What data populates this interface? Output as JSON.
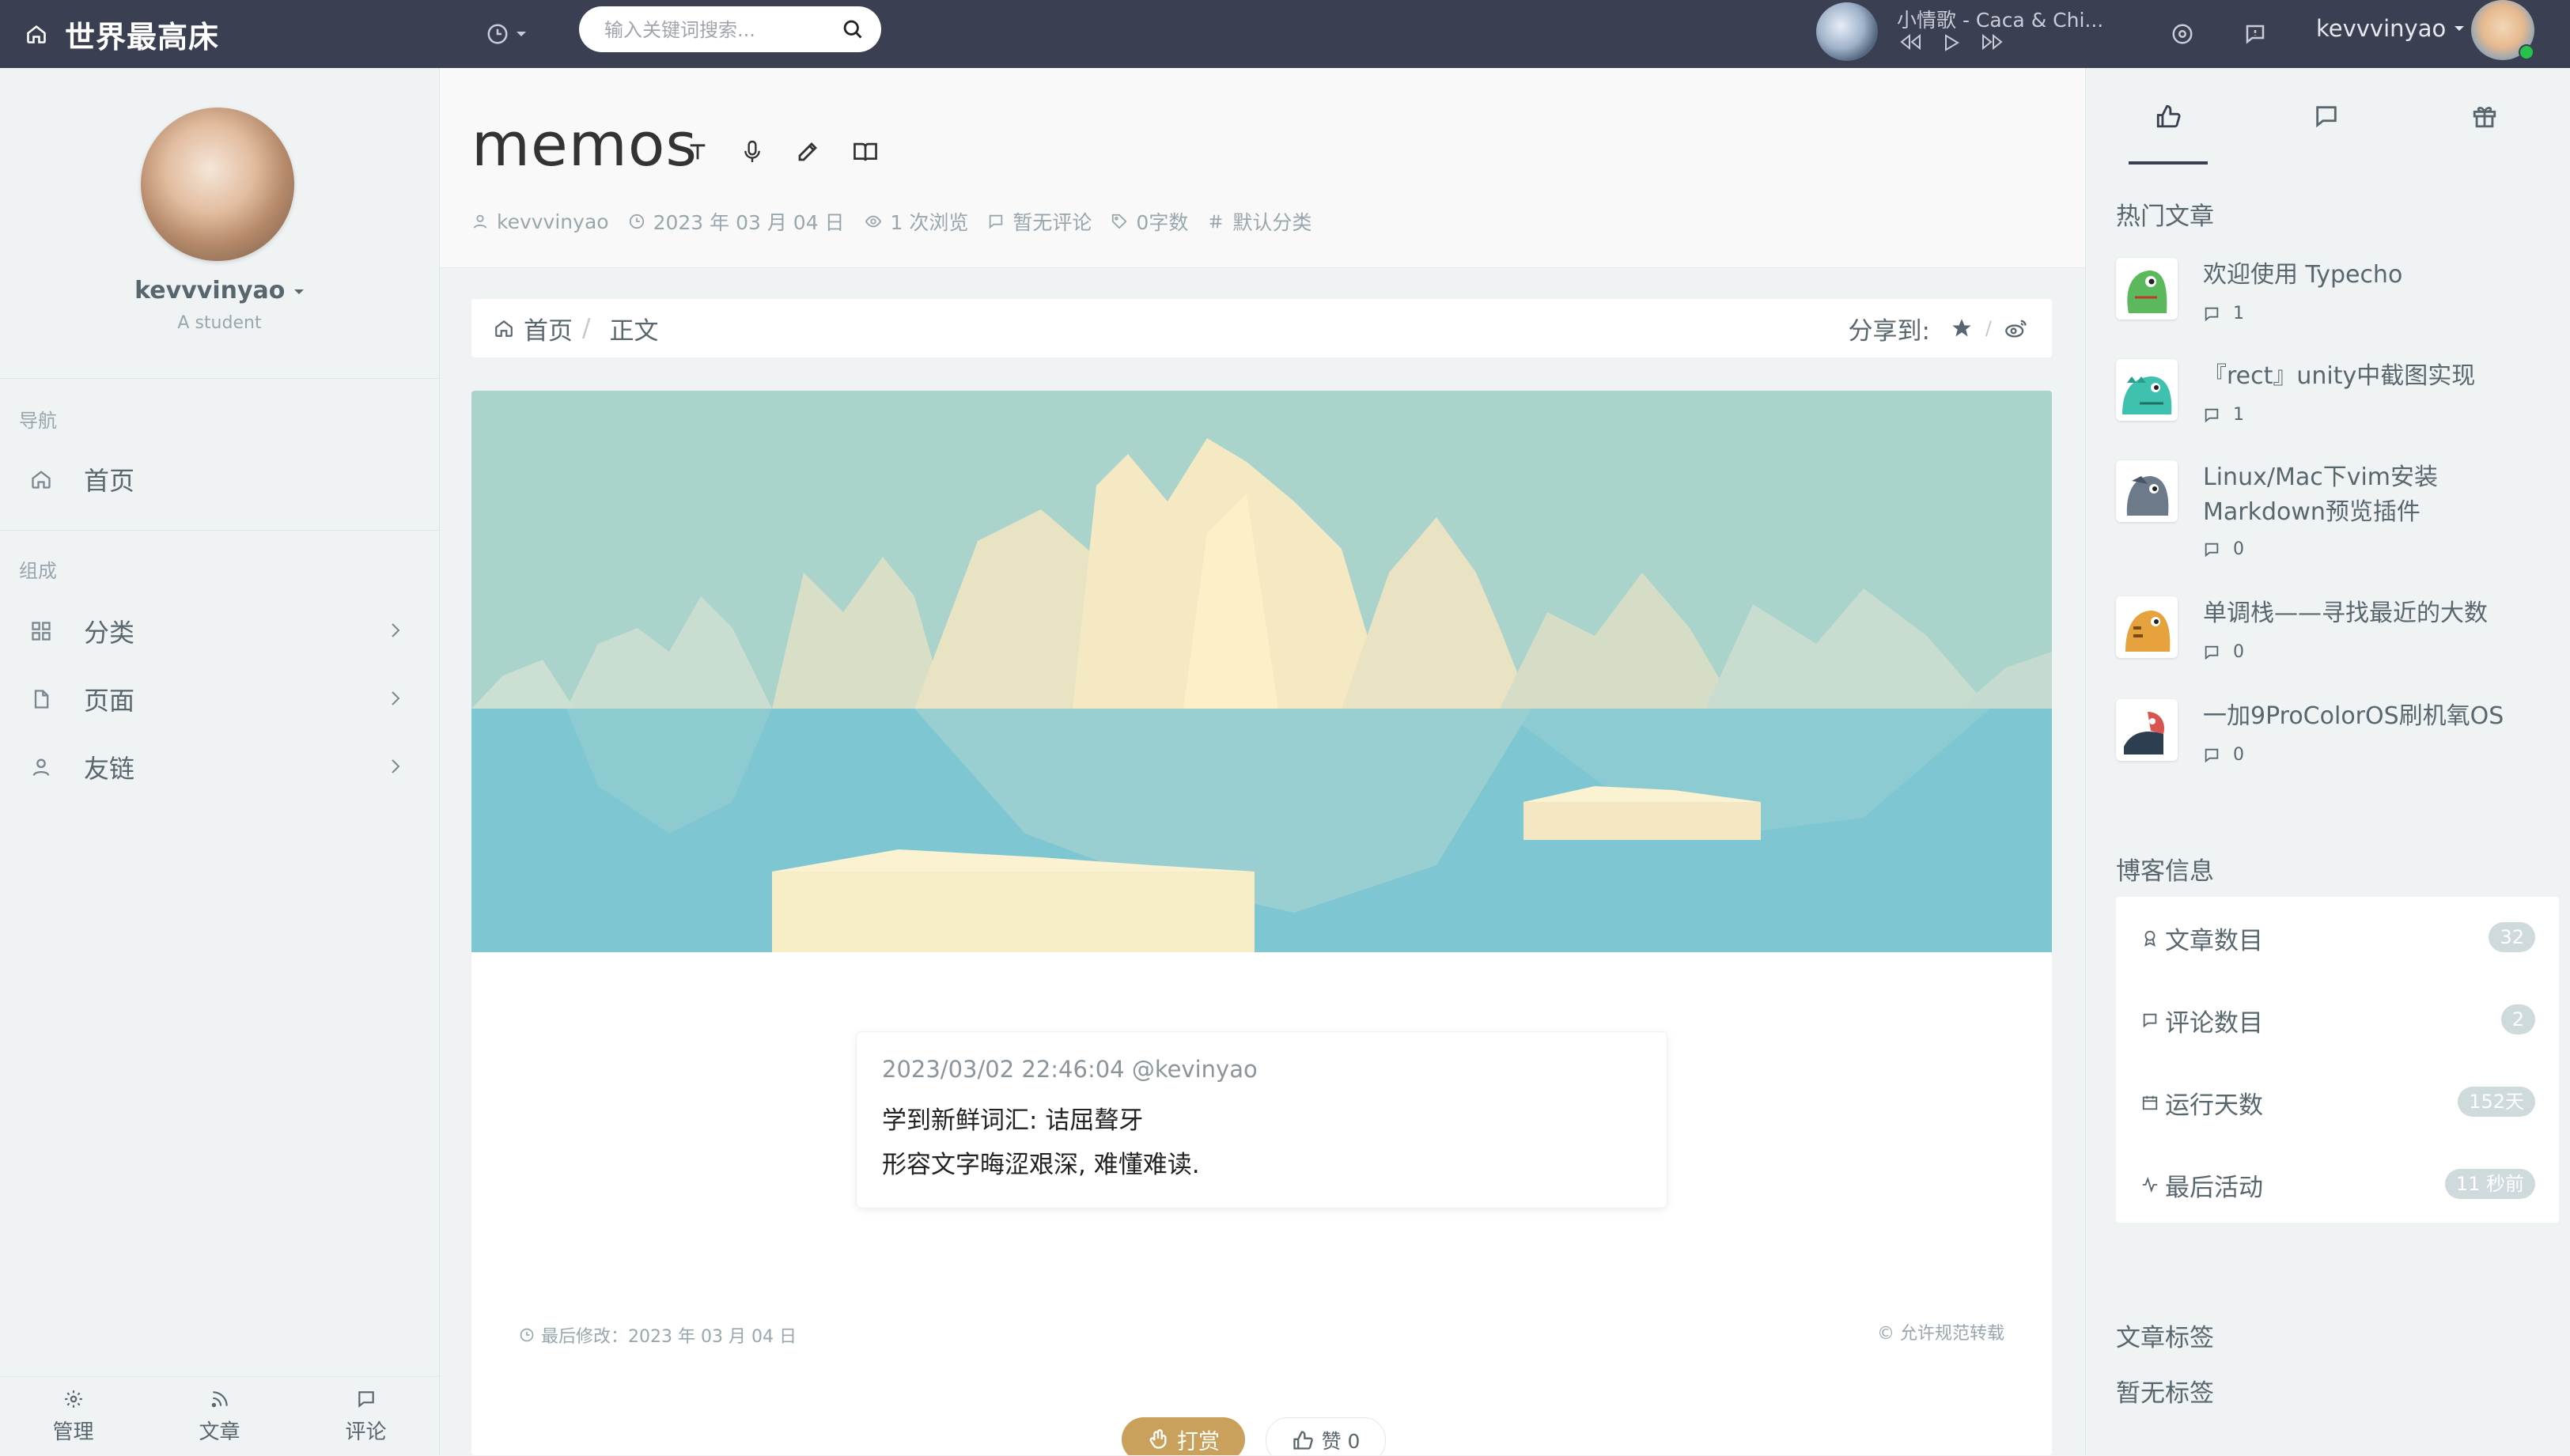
{
  "header": {
    "site_title": "世界最高床",
    "search_placeholder": "输入关键词搜索...",
    "song": "小情歌 - Caca & Chi...",
    "user_name": "kevvvinyao"
  },
  "aside": {
    "name": "kevvvinyao",
    "subtitle": "A student",
    "nav_heading": "导航",
    "home": "首页",
    "compose_heading": "组成",
    "items": [
      {
        "label": "分类"
      },
      {
        "label": "页面"
      },
      {
        "label": "友链"
      }
    ],
    "footer": [
      {
        "label": "管理"
      },
      {
        "label": "文章"
      },
      {
        "label": "评论"
      }
    ]
  },
  "post": {
    "title": "memos",
    "meta": {
      "author": "kevvvinyao",
      "date": "2023 年 03 月 04 日",
      "views": "1 次浏览",
      "comments": "暂无评论",
      "words": "0字数",
      "category": "默认分类"
    },
    "breadcrumb": {
      "home": "首页",
      "current": "正文"
    },
    "share_label": "分享到:",
    "memo": {
      "time": "2023/03/02 22:46:04  @kevinyao",
      "line1": "学到新鲜词汇: 诘屈聱牙",
      "line2": "形容文字晦涩艰深, 难懂难读."
    },
    "last_modified": "最后修改：2023 年 03 月 04 日",
    "copyright": "© 允许规范转载",
    "reward_label": "打赏",
    "like_label": "赞 0"
  },
  "right": {
    "hot_heading": "热门文章",
    "hot": [
      {
        "title": "欢迎使用 Typecho",
        "comments": "1",
        "color": "#5cb85c"
      },
      {
        "title": "『rect』unity中截图实现",
        "comments": "1",
        "color": "#3fc1b0"
      },
      {
        "title": "Linux/Mac下vim安装Markdown预览插件",
        "comments": "0",
        "color": "#6c7a8a"
      },
      {
        "title": "单调栈——寻找最近的大数",
        "comments": "0",
        "color": "#e6a23c"
      },
      {
        "title": "一加9ProColorOS刷机氧OS",
        "comments": "0",
        "color": "#d9534f"
      }
    ],
    "blog_info_heading": "博客信息",
    "info": [
      {
        "label": "文章数目",
        "value": "32"
      },
      {
        "label": "评论数目",
        "value": "2"
      },
      {
        "label": "运行天数",
        "value": "152天"
      },
      {
        "label": "最后活动",
        "value": "11 秒前"
      }
    ],
    "tags_heading": "文章标签",
    "no_tags": "暂无标签"
  }
}
